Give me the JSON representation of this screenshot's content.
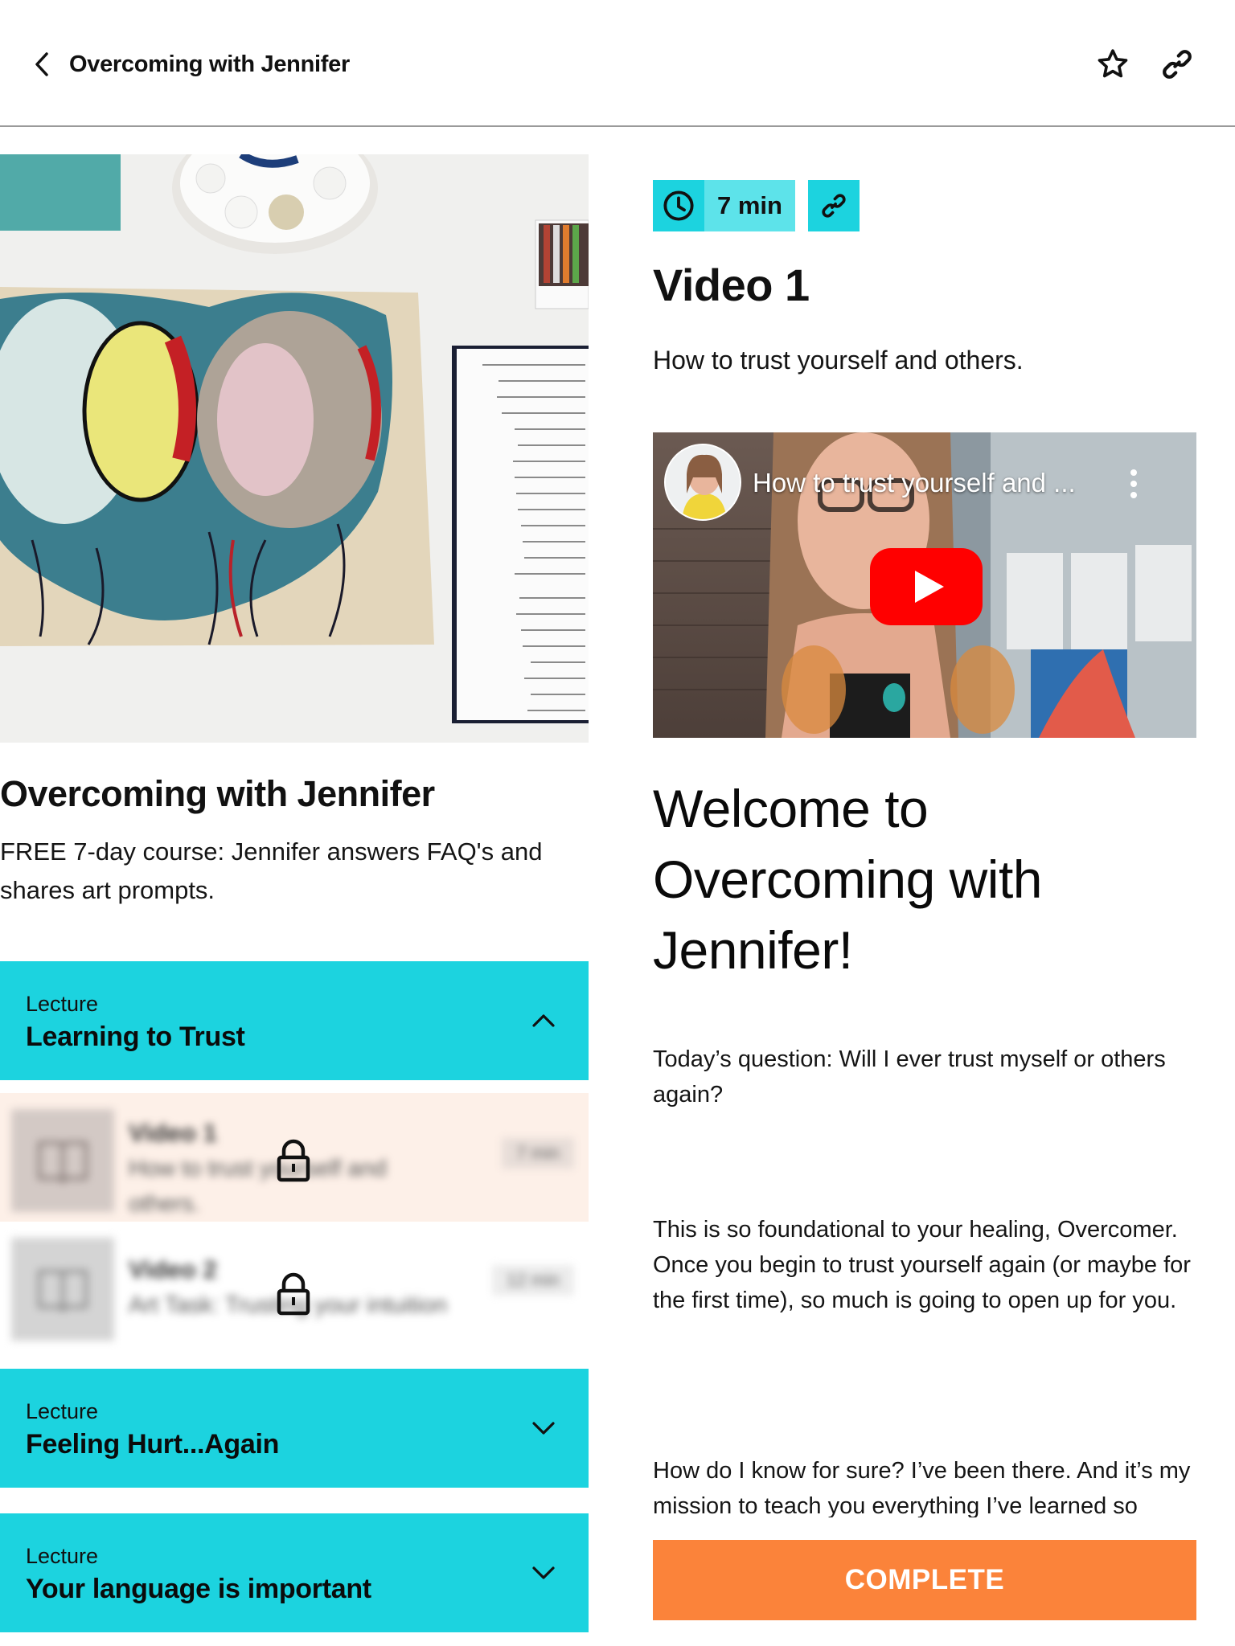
{
  "header": {
    "title": "Overcoming with Jennifer",
    "back_icon": "chevron-left-icon",
    "favorite_icon": "star-outline-icon",
    "share_icon": "link-icon"
  },
  "course": {
    "cover_alt": "Abstract oil pastel and watercolor artwork beside a handwritten journal",
    "title": "Overcoming with Jennifer",
    "description": "FREE 7-day course: Jennifer answers FAQ's and shares art prompts."
  },
  "lectures": [
    {
      "kind": "Lecture",
      "name": "Learning to Trust",
      "expanded": true,
      "lessons": [
        {
          "title": "Video 1",
          "subtitle": "How to trust yourself and others.",
          "duration": "7 min",
          "locked": true,
          "active": true
        },
        {
          "title": "Video 2",
          "subtitle": "Art Task: Trusting your intuition",
          "duration": "12 min",
          "locked": true,
          "active": false
        }
      ]
    },
    {
      "kind": "Lecture",
      "name": "Feeling Hurt...Again",
      "expanded": false
    },
    {
      "kind": "Lecture",
      "name": "Your language is important",
      "expanded": false
    }
  ],
  "lesson": {
    "duration": "7 min",
    "title": "Video 1",
    "subtitle": "How to trust yourself and others.",
    "video": {
      "title": "How to trust yourself and ...",
      "provider": "YouTube"
    },
    "welcome_heading": "Welcome to Overcoming with Jennifer!",
    "paragraphs": [
      "Today’s question: Will I ever trust myself or others again?",
      "This is so foundational to your healing, Overcomer. Once you begin to trust yourself again (or maybe for the first time), so much is going to open up for you.",
      "How do I know for sure? I’ve been there. And it’s my mission to teach you everything I’ve learned so"
    ],
    "complete_label": "COMPLETE"
  },
  "colors": {
    "accent_cyan": "#1cd3df",
    "accent_cyan_light": "#5de3ea",
    "complete_orange": "#fb833a",
    "active_lesson_bg": "#fdf0e8",
    "youtube_red": "#ff0000"
  }
}
